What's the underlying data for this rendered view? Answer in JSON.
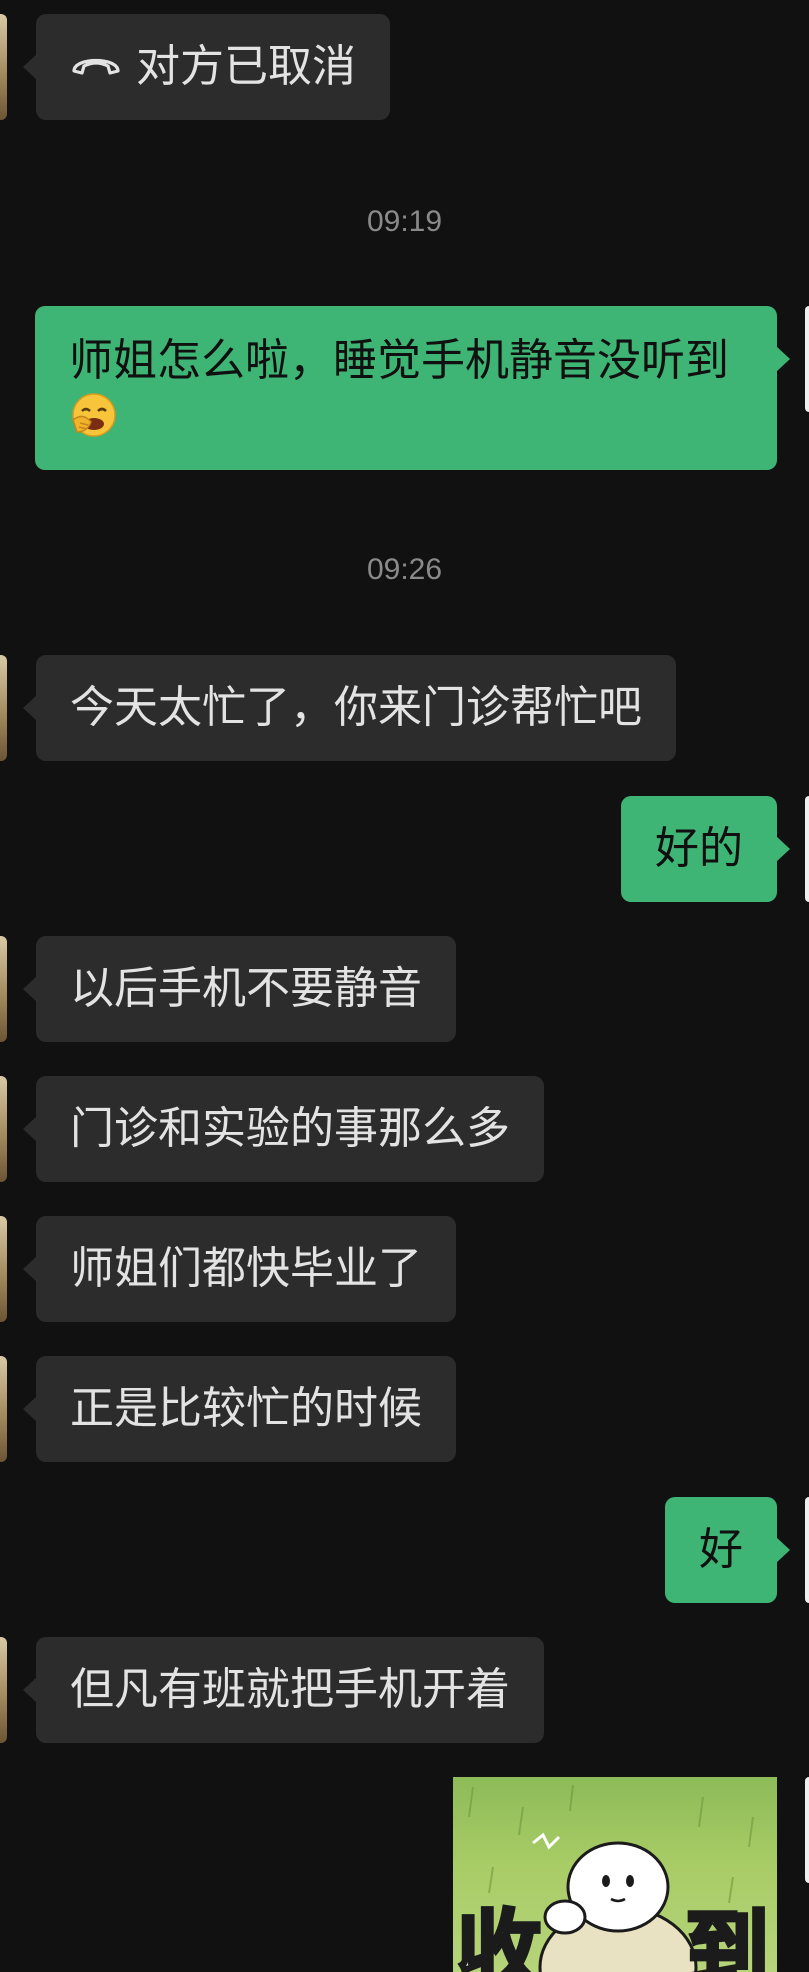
{
  "messages": {
    "call_cancelled": "对方已取消",
    "time_1": "09:19",
    "out_1_line1": "师姐怎么啦，睡觉手机静音没听到",
    "time_2": "09:26",
    "in_1": "今天太忙了，你来门诊帮忙吧",
    "out_2": "好的",
    "in_2": "以后手机不要静音",
    "in_3": "门诊和实验的事那么多",
    "in_4": "师姐们都快毕业了",
    "in_5": "正是比较忙的时候",
    "out_3": "好",
    "in_6": "但凡有班就把手机开着"
  },
  "sticker": {
    "text_left": "收",
    "text_right": "到"
  },
  "icons": {
    "call": "phone-hangup-icon",
    "emoji": "face-with-hand-over-mouth-emoji"
  },
  "colors": {
    "background": "#111111",
    "incoming_bubble": "#2c2c2c",
    "outgoing_bubble": "#3eb575",
    "timestamp": "#8a8a8a"
  }
}
